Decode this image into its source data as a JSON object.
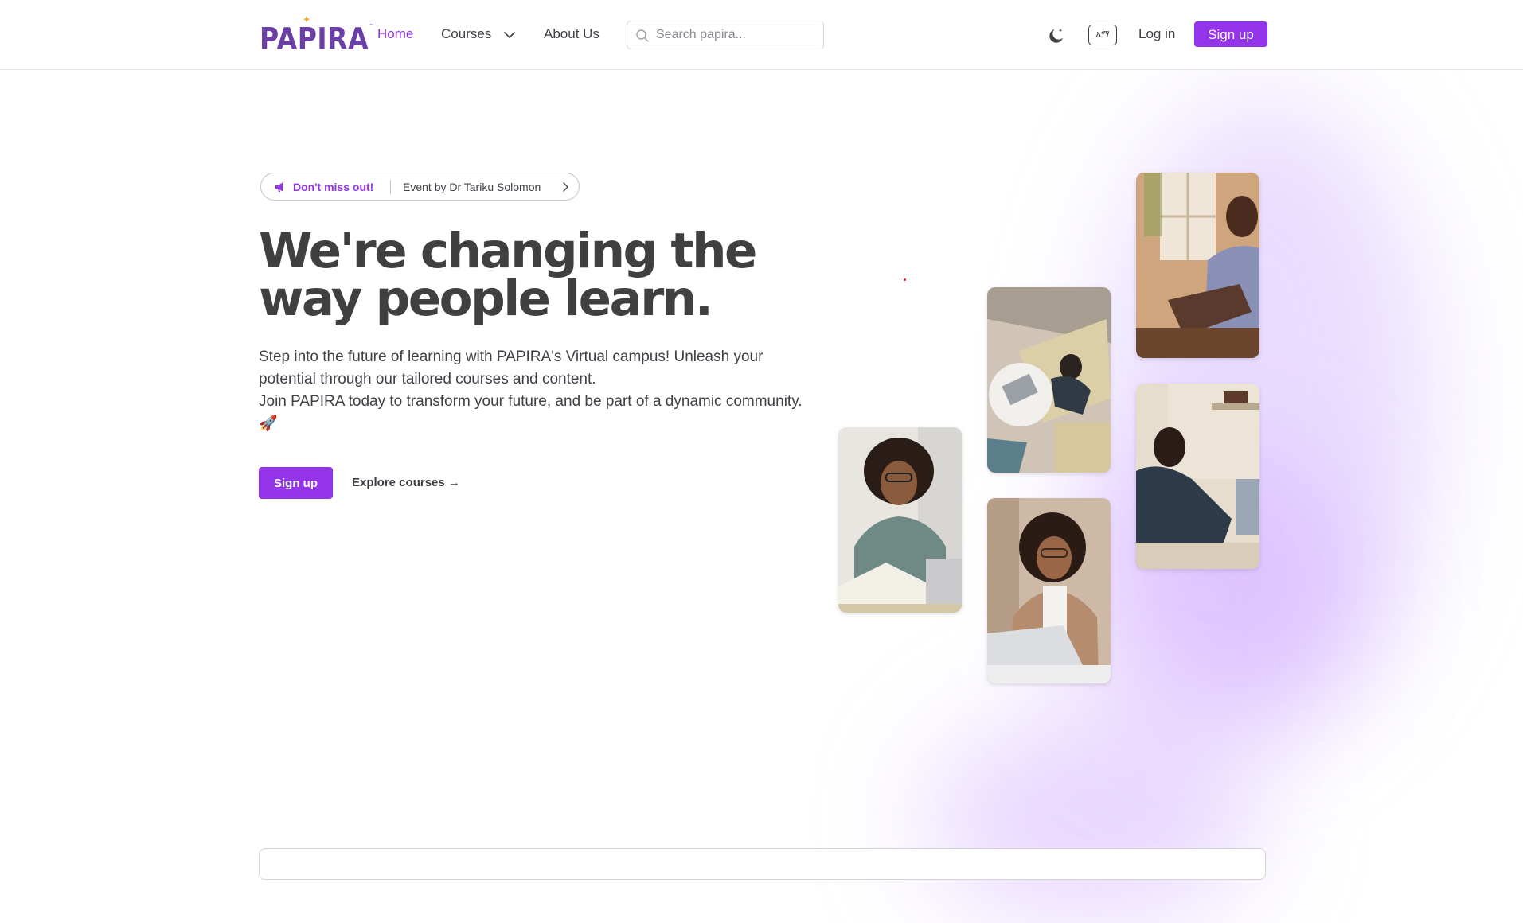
{
  "header": {
    "logo_text": "PAPIRA",
    "nav": [
      {
        "label": "Home",
        "active": true
      },
      {
        "label": "Courses",
        "has_dropdown": true
      },
      {
        "label": "About Us"
      }
    ],
    "search_placeholder": "Search papira...",
    "language_badge": "አማ",
    "login_label": "Log in",
    "signup_label": "Sign up"
  },
  "announcement": {
    "highlight": "Don't miss out!",
    "event_text": "Event by Dr Tariku Solomon"
  },
  "hero": {
    "title": "We're changing the way people learn.",
    "description_line1": "Step into the future of learning with PAPIRA's Virtual campus! Unleash your potential through our tailored courses and content.",
    "description_line2": "Join PAPIRA today to transform your future, and be part of a dynamic community.",
    "description_emoji": "🚀",
    "signup_label": "Sign up",
    "explore_label": "Explore courses →"
  },
  "colors": {
    "brand_purple": "#9333ea",
    "logo_purple": "#6b3fa8",
    "text_dark": "#3f3f46"
  },
  "icons": [
    "search-icon",
    "chevron-down-icon",
    "moon-icon",
    "megaphone-icon",
    "chevron-right-icon",
    "rocket-icon"
  ]
}
